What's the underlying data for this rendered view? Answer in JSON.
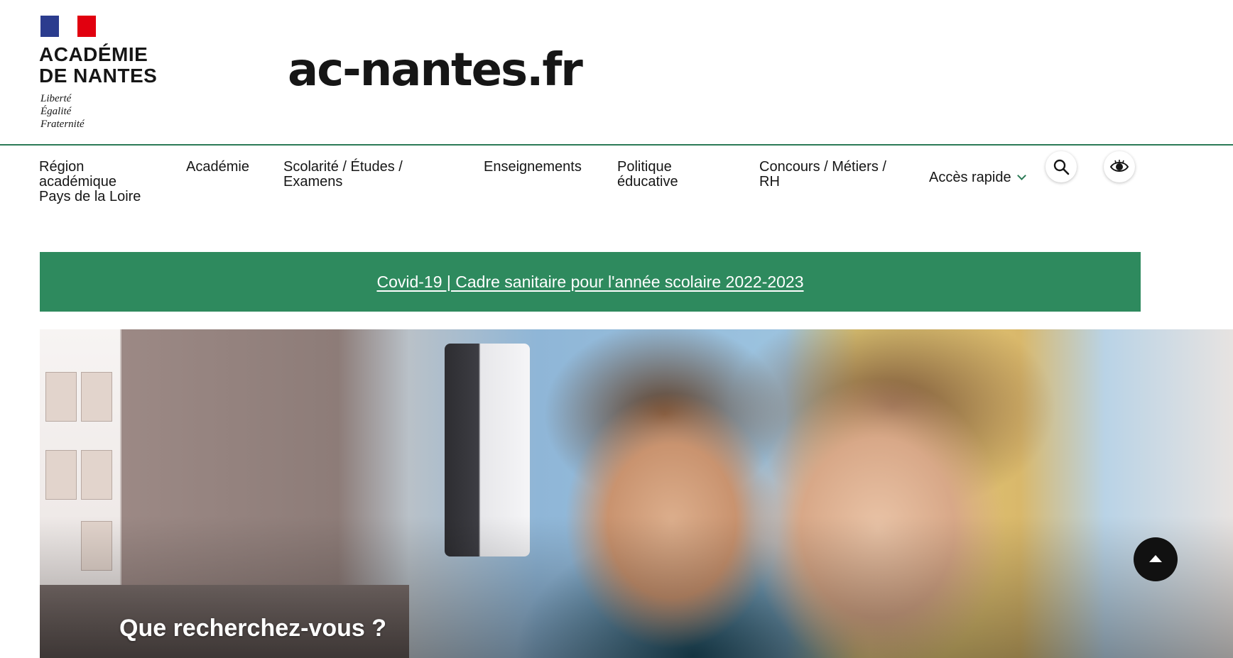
{
  "header": {
    "logo_title_line1": "ACADÉMIE",
    "logo_title_line2": "DE NANTES",
    "devise_1": "Liberté",
    "devise_2": "Égalité",
    "devise_3": "Fraternité",
    "site_name": "ac-nantes.fr"
  },
  "nav": {
    "items": [
      {
        "label_lines": [
          "Région",
          "académique",
          "Pays de la Loire"
        ]
      },
      {
        "label_lines": [
          "Académie"
        ]
      },
      {
        "label_lines": [
          "Scolarité / Études /",
          "Examens"
        ]
      },
      {
        "label_lines": [
          "Enseignements"
        ]
      },
      {
        "label_lines": [
          "Politique",
          "éducative"
        ]
      },
      {
        "label_lines": [
          "Concours / Métiers /",
          "RH"
        ]
      }
    ],
    "quick_access": "Accès rapide",
    "search_icon": "search-icon",
    "display_icon": "eye-icon"
  },
  "banner": {
    "text": "Covid-19 | Cadre sanitaire pour l'année scolaire 2022-2023",
    "color": "#2e8a5e"
  },
  "hero": {
    "question": "Que recherchez-vous ?"
  },
  "colors": {
    "accent_green": "#2b7a56",
    "flag_blue": "#2b3c8e",
    "flag_red": "#e1000f"
  }
}
